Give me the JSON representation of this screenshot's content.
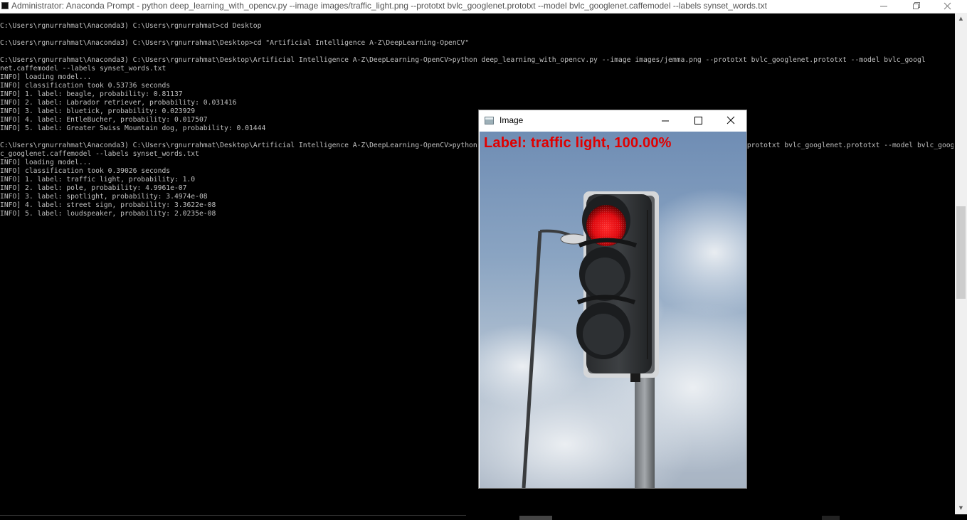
{
  "console": {
    "title": "Administrator: Anaconda Prompt - python  deep_learning_with_opencv.py --image images/traffic_light.png --prototxt bvlc_googlenet.prototxt --model bvlc_googlenet.caffemodel --labels synset_words.txt",
    "lines": [
      "C:\\Users\\rgnurrahmat\\Anaconda3) C:\\Users\\rgnurrahmat>cd Desktop",
      "",
      "C:\\Users\\rgnurrahmat\\Anaconda3) C:\\Users\\rgnurrahmat\\Desktop>cd \"Artificial Intelligence A-Z\\DeepLearning-OpenCV\"",
      "",
      "C:\\Users\\rgnurrahmat\\Anaconda3) C:\\Users\\rgnurrahmat\\Desktop\\Artificial Intelligence A-Z\\DeepLearning-OpenCV>python deep_learning_with_opencv.py --image images/jemma.png --prototxt bvlc_googlenet.prototxt --model bvlc_googl",
      "net.caffemodel --labels synset_words.txt",
      "INFO] loading model...",
      "INFO] classification took 0.53736 seconds",
      "INFO] 1. label: beagle, probability: 0.81137",
      "INFO] 2. label: Labrador retriever, probability: 0.031416",
      "INFO] 3. label: bluetick, probability: 0.023929",
      "INFO] 4. label: EntleBucher, probability: 0.017507",
      "INFO] 5. label: Greater Swiss Mountain dog, probability: 0.01444",
      "",
      "C:\\Users\\rgnurrahmat\\Anaconda3) C:\\Users\\rgnurrahmat\\Desktop\\Artificial Intelligence A-Z\\DeepLearning-OpenCV>python deep_learning_with_opencv.py --image images/traffic_light.png --prototxt bvlc_googlenet.prototxt --model bvlc_googl",
      "c_googlenet.caffemodel --labels synset_words.txt",
      "INFO] loading model...",
      "INFO] classification took 0.39026 seconds",
      "INFO] 1. label: traffic light, probability: 1.0",
      "INFO] 2. label: pole, probability: 4.9961e-07",
      "INFO] 3. label: spotlight, probability: 3.4974e-08",
      "INFO] 4. label: street sign, probability: 3.3622e-08",
      "INFO] 5. label: loudspeaker, probability: 2.0235e-08"
    ]
  },
  "image_window": {
    "title": "Image",
    "label_text": "Label: traffic light, 100.00%"
  },
  "colors": {
    "label_red": "#e00000",
    "console_text": "#c0c0c0",
    "console_bg": "#000000"
  },
  "icons": {
    "console_app": "cmd-icon",
    "image_app": "window-icon",
    "minimize": "minimize-icon",
    "maximize": "maximize-icon",
    "close": "close-icon"
  }
}
